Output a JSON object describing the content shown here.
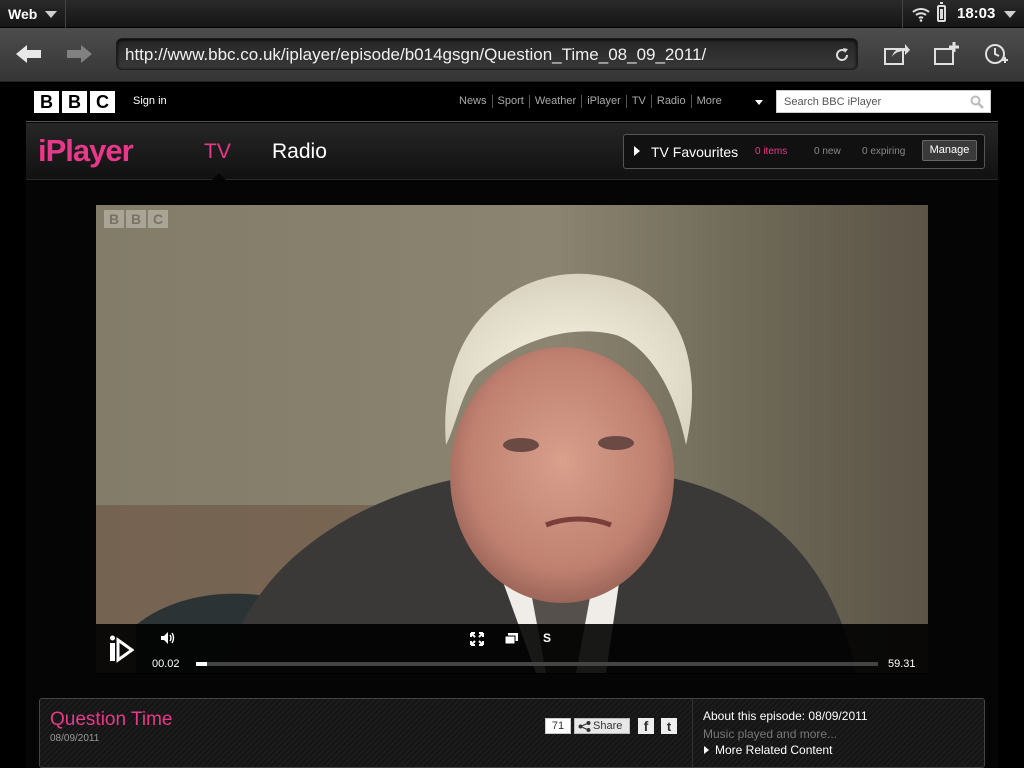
{
  "system_bar": {
    "app_name": "Web",
    "time": "18:03"
  },
  "browser": {
    "url": "http://www.bbc.co.uk/iplayer/episode/b014gsgn/Question_Time_08_09_2011/"
  },
  "bbc_bar": {
    "logo_letters": [
      "B",
      "B",
      "C"
    ],
    "sign_in": "Sign in",
    "nav": [
      "News",
      "Sport",
      "Weather",
      "iPlayer",
      "TV",
      "Radio",
      "More"
    ],
    "search_placeholder": "Search BBC iPlayer"
  },
  "iplayer_bar": {
    "logo": "iPlayer",
    "tabs": [
      {
        "label": "TV",
        "active": true
      },
      {
        "label": "Radio",
        "active": false
      }
    ],
    "favourites": {
      "label": "TV Favourites",
      "items": "0 items",
      "new": "0 new",
      "expiring": "0 expiring",
      "manage": "Manage"
    }
  },
  "player": {
    "watermark": [
      "B",
      "B",
      "C"
    ],
    "subtitles_label": "S",
    "current_time": "00.02",
    "duration": "59.31",
    "progress": 0.005
  },
  "episode": {
    "title": "Question Time",
    "date": "08/09/2011",
    "share_count": "71",
    "share_label": "Share",
    "facebook": "f",
    "twitter": "t",
    "about_title": "About this episode: 08/09/2011",
    "about_desc": "Music played and more...",
    "related": "More Related Content"
  },
  "colors": {
    "iplayer_pink": "#e8388a"
  }
}
